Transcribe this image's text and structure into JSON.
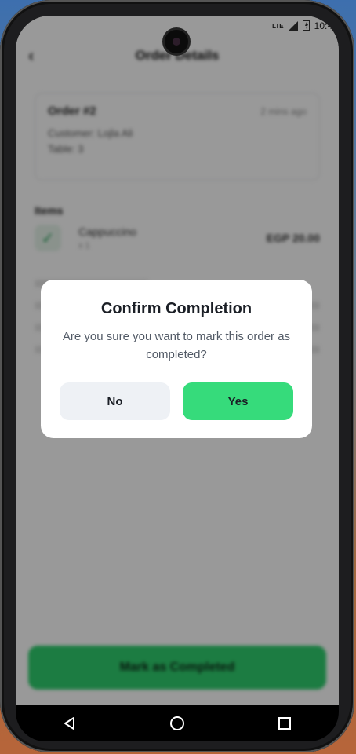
{
  "status_bar": {
    "network": "LTE",
    "time": "10:4"
  },
  "app": {
    "title": "Order Details",
    "order": {
      "id": "Order #2",
      "time_ago": "2 mins ago",
      "customer": "Customer: Lojla Ali",
      "table": "Table: 3"
    },
    "items_section_title": "Items",
    "items": [
      {
        "name": "Cappuccino",
        "qty": "x 1",
        "price": "EGP 20.00"
      }
    ],
    "complete_button_label": "Mark as Completed"
  },
  "dialog": {
    "title": "Confirm Completion",
    "message": "Are you sure you want to mark this order as completed?",
    "no_label": "No",
    "yes_label": "Yes"
  },
  "colors": {
    "accent_green": "#36db7b",
    "no_button_bg": "#eef1f5"
  },
  "icons": {
    "back": "back-arrow-icon",
    "check": "check-icon",
    "nav_back": "nav-back-icon",
    "nav_home": "nav-home-icon",
    "nav_recents": "nav-recents-icon"
  }
}
